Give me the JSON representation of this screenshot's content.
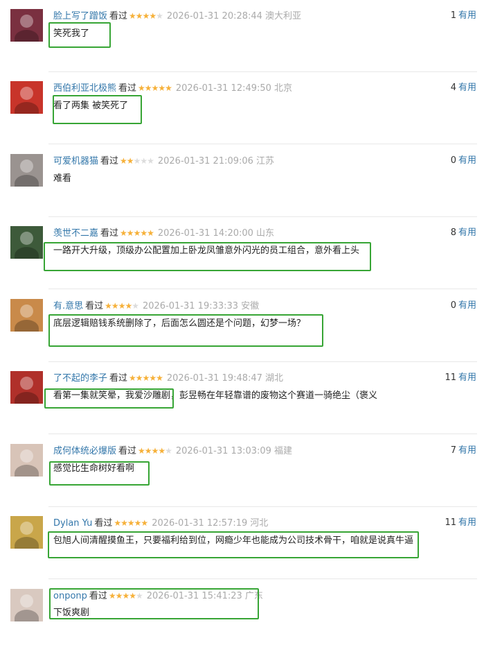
{
  "reviews": [
    {
      "author": "脸上写了蹭饭",
      "watched": "看过",
      "rating": 4,
      "time": "2026-01-31 20:28:44",
      "location": "澳大利亚",
      "votes": "1",
      "votes_unit": "有用",
      "text": "笑死我了",
      "avatar_color": "#7a3040"
    },
    {
      "author": "西伯利亚北极熊",
      "watched": "看过",
      "rating": 5,
      "time": "2026-01-31 12:49:50",
      "location": "北京",
      "votes": "4",
      "votes_unit": "有用",
      "text": "看了两集 被笑死了",
      "avatar_color": "#c8342a"
    },
    {
      "author": "可爱机器猫",
      "watched": "看过",
      "rating": 2,
      "time": "2026-01-31 21:09:06",
      "location": "江苏",
      "votes": "0",
      "votes_unit": "有用",
      "text": "难看",
      "avatar_color": "#9a9390"
    },
    {
      "author": "羡世不二嘉",
      "watched": "看过",
      "rating": 5,
      "time": "2026-01-31 14:20:00",
      "location": "山东",
      "votes": "8",
      "votes_unit": "有用",
      "text": "一路开大升级，顶级办公配置加上卧龙凤雏意外闪光的员工组合，意外看上头",
      "avatar_color": "#3d5a3a"
    },
    {
      "author": "有.意思",
      "watched": "看过",
      "rating": 4,
      "time": "2026-01-31 19:33:33",
      "location": "安徽",
      "votes": "0",
      "votes_unit": "有用",
      "text": "底层逻辑赔钱系统删除了，后面怎么圆还是个问题，幻梦一场？",
      "avatar_color": "#c98a4a"
    },
    {
      "author": "了不起的李子",
      "watched": "看过",
      "rating": 5,
      "time": "2026-01-31 19:48:47",
      "location": "湖北",
      "votes": "11",
      "votes_unit": "有用",
      "text": "看第一集就笑晕，我爱沙雕剧，彭昱畅在年轻靠谱的废物这个赛道一骑绝尘（褒义",
      "avatar_color": "#b0302a"
    },
    {
      "author": "成何体统必爆版",
      "watched": "看过",
      "rating": 4,
      "time": "2026-01-31 13:03:09",
      "location": "福建",
      "votes": "7",
      "votes_unit": "有用",
      "text": "感觉比生命树好看啊",
      "avatar_color": "#d8c4b8"
    },
    {
      "author": "Dylan Yu",
      "watched": "看过",
      "rating": 5,
      "time": "2026-01-31 12:57:19",
      "location": "河北",
      "votes": "11",
      "votes_unit": "有用",
      "text": "包旭人间清醒摸鱼王，只要福利给到位，网瘾少年也能成为公司技术骨干，咱就是说真牛逼",
      "avatar_color": "#c9a64a"
    },
    {
      "author": "onponp",
      "watched": "看过",
      "rating": 4,
      "time": "2026-01-31 15:41:23",
      "location": "广东",
      "votes": "",
      "votes_unit": "",
      "text": "下饭爽剧",
      "avatar_color": "#d9c9c0"
    }
  ]
}
